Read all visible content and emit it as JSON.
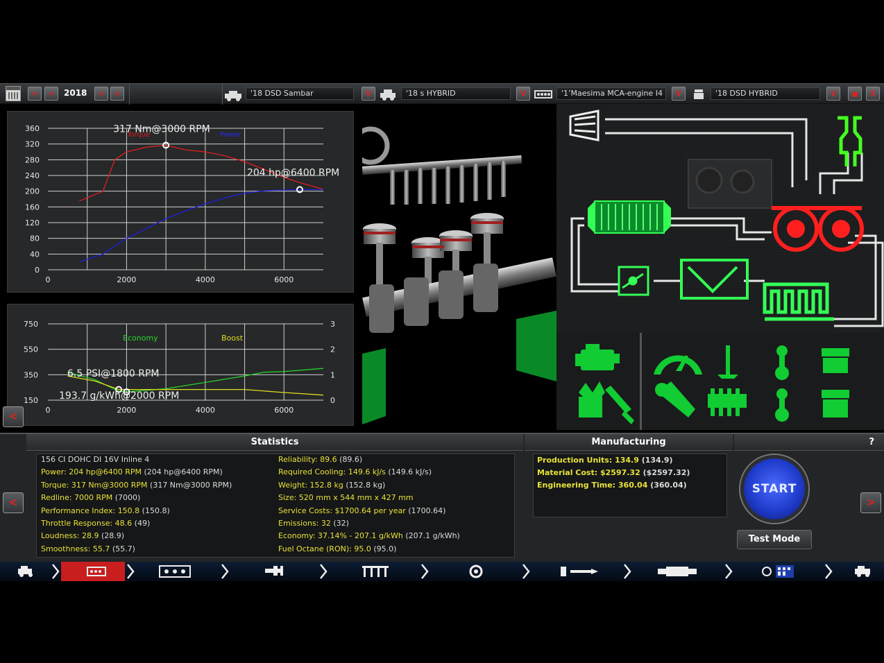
{
  "topbar": {
    "year": "2018",
    "car_model": "'18      DSD  Sambar",
    "car_trim": "'18            s HYBRID",
    "engine_family": "'1’Maesima MCA-engine I4",
    "engine_variant": "'18        DSD HYBRID",
    "prev_label": "<",
    "next_label": ">",
    "dropdown_label": "V",
    "save_label": "■",
    "close_label": "X"
  },
  "torque_power_chart": {
    "chart_data": {
      "type": "line",
      "x_ticks": [
        "0",
        "2000",
        "4000",
        "6000"
      ],
      "y_ticks": [
        "0",
        "40",
        "80",
        "120",
        "160",
        "200",
        "240",
        "280",
        "320",
        "360"
      ],
      "xlim": [
        0,
        7000
      ],
      "ylim": [
        0,
        360
      ],
      "series": [
        {
          "name": "Torque",
          "color": "#e02020",
          "x": [
            800,
            1400,
            1700,
            2000,
            2500,
            3000,
            3500,
            4000,
            4500,
            5000,
            5500,
            6000,
            6400,
            7000
          ],
          "values": [
            175,
            200,
            280,
            300,
            312,
            317,
            305,
            300,
            290,
            275,
            255,
            235,
            222,
            205
          ]
        },
        {
          "name": "Power",
          "color": "#2020e0",
          "x": [
            800,
            1400,
            2000,
            2500,
            3000,
            3500,
            4000,
            4500,
            5000,
            5500,
            6000,
            6400,
            7000
          ],
          "values": [
            20,
            40,
            80,
            105,
            130,
            150,
            168,
            183,
            195,
            201,
            203,
            204,
            204
          ]
        }
      ],
      "annotations": [
        {
          "text": "317 Nm@3000 RPM",
          "x": 3000,
          "y": 317
        },
        {
          "text": "204 hp@6400 RPM",
          "x": 6400,
          "y": 204
        }
      ]
    }
  },
  "economy_boost_chart": {
    "chart_data": {
      "type": "line",
      "x_ticks": [
        "0",
        "2000",
        "4000",
        "6000"
      ],
      "y_ticks_left": [
        "150",
        "350",
        "550",
        "750"
      ],
      "y_ticks_right": [
        "0",
        "1",
        "2",
        "3"
      ],
      "xlim": [
        0,
        7000
      ],
      "ylim_left": [
        150,
        750
      ],
      "ylim_right": [
        0,
        3
      ],
      "series": [
        {
          "name": "Economy",
          "color": "#2ad42a",
          "axis": "left",
          "x": [
            500,
            1200,
            1800,
            2000,
            3000,
            4000,
            5000,
            5500,
            6000,
            7000
          ],
          "values": [
            370,
            310,
            220,
            215,
            240,
            290,
            340,
            370,
            375,
            400
          ]
        },
        {
          "name": "Boost",
          "color": "#dddd20",
          "axis": "right",
          "x": [
            500,
            1200,
            1800,
            2000,
            3000,
            4000,
            5000,
            6000,
            7000
          ],
          "values": [
            0.95,
            0.75,
            0.42,
            0.42,
            0.42,
            0.42,
            0.42,
            0.3,
            0.2
          ]
        }
      ],
      "annotations": [
        {
          "text": "6.5 PSI@1800 RPM",
          "x": 1800
        },
        {
          "text": "193.7 g/kWh@2000 RPM",
          "x": 2000
        }
      ]
    }
  },
  "statistics": {
    "title": "Statistics",
    "left": [
      {
        "text": "156 CI DOHC DI 16V Inline 4",
        "extra": ""
      },
      {
        "text": "Power: 204 hp@6400 RPM",
        "extra": " (204 hp@6400 RPM)"
      },
      {
        "text": "Torque: 317 Nm@3000 RPM",
        "extra": " (317 Nm@3000 RPM)"
      },
      {
        "text": "Redline: 7000 RPM",
        "extra": " (7000)"
      },
      {
        "text": "Performance Index: 150.8",
        "extra": " (150.8)"
      },
      {
        "text": "Throttle Response: 48.6",
        "extra": " (49)"
      },
      {
        "text": "Loudness: 28.9",
        "extra": " (28.9)"
      },
      {
        "text": "Smoothness: 55.7",
        "extra": " (55.7)"
      }
    ],
    "right": [
      {
        "text": "Reliability: 89.6",
        "extra": " (89.6)"
      },
      {
        "text": "Required Cooling: 149.6 kJ/s",
        "extra": " (149.6 kJ/s)"
      },
      {
        "text": "Weight: 152.8 kg",
        "extra": " (152.8 kg)"
      },
      {
        "text": "Size: 520 mm x 544 mm x 427 mm",
        "extra": ""
      },
      {
        "text": "Service Costs: $1700.64 per year",
        "extra": " (1700.64)"
      },
      {
        "text": "Emissions: 32",
        "extra": " (32)"
      },
      {
        "text": "Economy: 37.14% - 207.1 g/kWh",
        "extra": " (207.1 g/kWh)"
      },
      {
        "text": "Fuel Octane (RON): 95.0",
        "extra": " (95.0)"
      }
    ]
  },
  "manufacturing": {
    "title": "Manufacturing",
    "rows": [
      {
        "text": "Production Units: 134.9",
        "extra": " (134.9)"
      },
      {
        "text": "Material Cost: $2597.32",
        "extra": " ($2597.32)"
      },
      {
        "text": "Engineering Time: 360.04",
        "extra": " (360.04)"
      }
    ]
  },
  "controls": {
    "help_label": "?",
    "start_label": "START",
    "test_mode_label": "Test Mode",
    "back_label": "<",
    "forward_label": ">"
  },
  "bottom_nav": {
    "icons": [
      "car-icon",
      "engine-block-icon",
      "head-icon",
      "crank-icon",
      "valves-icon",
      "turbo-icon",
      "fuel-icon",
      "exhaust-icon",
      "tune-icon",
      "test-icon"
    ],
    "active_color": "#c81e1e"
  }
}
